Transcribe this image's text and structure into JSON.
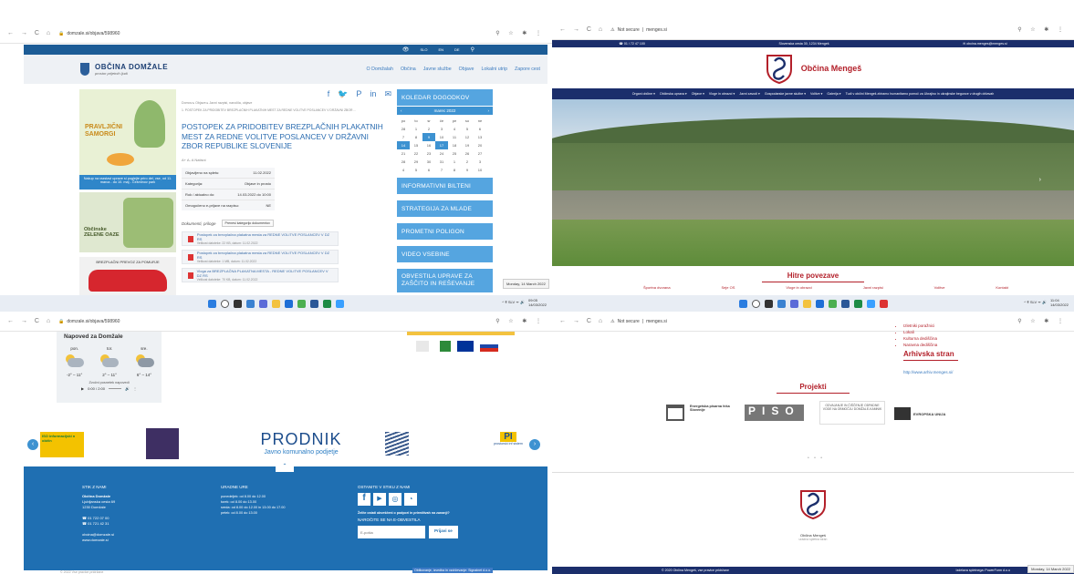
{
  "q1": {
    "url": "domzale.si/objava/598960",
    "logo_title": "OBČINA DOMŽALE",
    "logo_sub": "prostor prijetnih ljudi",
    "topbar_items": [
      "SLO",
      "EN",
      "DE"
    ],
    "nav": [
      "O Domžalah",
      "Občina",
      "Javne službe",
      "Objave",
      "Lokalni utrip",
      "Zapore cest"
    ],
    "breadcrumb": "Domov ▸ Objave ▸ Javni razpisi, naročila, objave",
    "breadcrumb2": "1. POSTOPEK ZA PRIDOBITEV BREZPLAČNIH PLAKATNIH MEST ZA REDNE VOLITVE POSLANCEV V DRŽAVNI ZBOR ...",
    "headline": "POSTOPEK ZA PRIDOBITEV BREZPLAČNIH PLAKATNIH MEST ZA REDNE VOLITVE POSLANCEV V DRŽAVNI ZBOR REPUBLIKE SLOVENIJE",
    "meta_small": "A+ A- A    Natisni",
    "info_rows": [
      {
        "label": "Objavljeno na spletu:",
        "value": "11.02.2022"
      },
      {
        "label": "Kategorija:",
        "value": "Objave in prosto"
      },
      {
        "label": "Rok / aktualno do:",
        "value": "14.03.2022 do 10:00"
      },
      {
        "label": "Omogočeno e-prijave na razpisu:",
        "value": "NE"
      }
    ],
    "docs_label": "Dokumenti, priloge",
    "docs_btn": "Prenesi kategorijo dokumentov",
    "docs": [
      {
        "title": "Postopek za brezplačna plakatna mesta za REDNE VOLITVE POSLANCEV V DZ RS",
        "meta": "Velikost datoteke: 22 KB, datum: 11.02.2022"
      },
      {
        "title": "Postopek za brezplačna plakatna mesta za REDNE VOLITVE POSLANCEV V DZ RS",
        "meta": "Velikost datoteke: 1 MB, datum: 11.02.2022"
      },
      {
        "title": "Vloga za BREZPLAČNA PLAKATNA MESTA - REDNE VOLITVE POSLANCEV V DZ RS",
        "meta": "Velikost datoteke: 70 KB, datum: 11.02.2022"
      }
    ],
    "calendar_title": "KOLEDAR DOGODKOV",
    "calendar_month": "marec 2022",
    "calendar_days": [
      "po",
      "to",
      "sr",
      "če",
      "pe",
      "so",
      "ne"
    ],
    "calendar_rows": [
      [
        "28",
        "1",
        "2",
        "3",
        "4",
        "5",
        "6"
      ],
      [
        "7",
        "8",
        "9",
        "10",
        "11",
        "12",
        "13"
      ],
      [
        "14",
        "15",
        "16",
        "17",
        "18",
        "19",
        "20"
      ],
      [
        "21",
        "22",
        "23",
        "24",
        "25",
        "26",
        "27"
      ],
      [
        "28",
        "29",
        "30",
        "31",
        "1",
        "2",
        "3"
      ],
      [
        "4",
        "5",
        "6",
        "7",
        "8",
        "9",
        "10"
      ]
    ],
    "side_buttons": [
      "INFORMATIVNI BILTENI",
      "STRATEGIJA ZA MLADE",
      "PROMETNI POLIGON",
      "VIDEO VSEBINE",
      "OBVESTILA UPRAVE ZA ZAŠČITO IN REŠEVANJE"
    ],
    "banner1_title": "PRAVLJIČNI SAMORGI",
    "banner1_text": "Nakup na razstavi uprave si poglejte priro del, vse, od 11. marca - do 10. maj - Češminov park",
    "banner2_title": "Občinske ZELENE OAZE",
    "banner3_title": "BREZPLAČNI PREVOZ ZA POMURJE",
    "date_tooltip": "Monday, 14 March 2022",
    "time": "09:05",
    "date": "14/03/2022"
  },
  "q2": {
    "url": "menges.si",
    "not_secure": "Not secure",
    "top_phone": "☎ 01 / 72 47 100",
    "top_address": "Slovenska cesta 30, 1234 Mengeš",
    "top_email": "✉ obcina.menges@menges.si",
    "title": "Občina Mengeš",
    "nav": [
      "Organi občine ▾",
      "Občinska uprava ▾",
      "Objave ▾",
      "Vloge in obrazci ▾",
      "Javni zavodi ▾",
      "Gospodarske javne službe ▾",
      "Volitve ▾",
      "Galerija ▾",
      "Tudi v občini Mengeš zbiramo humanitarno pomoč za Ukrajino in ukrajinske begunce v drugih državah"
    ],
    "quick_title": "Hitre povezave",
    "quick_links": [
      "Športna dvorana",
      "Seje OS",
      "Vloge in obrazci",
      "Javni razpisi",
      "Volitve",
      "Kontakt"
    ],
    "time": "11:04",
    "date": "14/03/2022"
  },
  "q3": {
    "url": "domzale.si/objava/598960",
    "weather_title": "Napoved za Domžale",
    "weather_days": [
      "pon.",
      "tor.",
      "sre."
    ],
    "weather_temps": [
      "-2° – 11°",
      "2° – 11°",
      "6° – 14°"
    ],
    "audio_label": "Zvočni posnetek napovedi",
    "audio_time": "0:00 / 2:00",
    "left_logo": "ISO informacijski n občin",
    "prodnik": "PRODNIK",
    "prodnik_sub": "Javno komunalno podjetje",
    "right_logo": "PI",
    "right_logo_sub": "prostorski inf sistem",
    "footer_c1_title": "STIK Z NAMI",
    "footer_c1_lines": [
      "Občina Domžale",
      "Ljubljanska cesta 69",
      "1230 Domžale",
      "",
      "01 722 07 00",
      "01 721 42 31",
      "",
      "obcina@domzale.si",
      "www.domzale.si"
    ],
    "footer_c2_title": "URADNE URE",
    "footer_c2_lines": [
      "ponedeljek: od 8.00 do 12.00",
      "torek: od 8.00 do 13.00",
      "sreda: od 8.00 do 12.00 in 13.00 do 17.00",
      "petek: od 8.00 do 13.00"
    ],
    "footer_c3_title": "OSTANITE V STIKU Z NAMI",
    "footer_c3_q": "Želite ostati obveščeni o podpori in prireditvah na zunanji?",
    "footer_c3_cta": "NAROČITE SE NA E-OBVESTILA",
    "email_placeholder": "E-pošta",
    "subscribe": "Prijavi se",
    "copyright": "© 2022 Vse pravice pridržane",
    "credit": "Oblikovanje, izvedba in vzdrževanje: Signalnet d.o.o."
  },
  "q4": {
    "url": "menges.si",
    "not_secure": "Not secure",
    "list": [
      "Izletniki poražnici",
      "Lokali",
      "Kulturna dediščina",
      "Naravna dediščina"
    ],
    "archive_title": "Arhivska stran",
    "archive_link": "http://www.arhiv.menges.si/",
    "projects_title": "Projekti",
    "proj1": "Energetska pisarna hiša Slovenije",
    "proj2": "PISO",
    "proj3": "ODVAJANJE IN ČIŠČENJE ODPADNE VODE NA OBMOČJU DOMŽALE-KAMNIK",
    "proj4": "EVROPSKA UNIJA",
    "logo_caption": "Občina Mengeš",
    "logo_caption_sub": "uradna spletna stran",
    "footer_left": "© 2020 Občina Mengeš, vse pravice pridržane",
    "footer_right": "Izdelava spletnega: PowerForm d.o.o",
    "date_tooltip": "Monday, 14 March 2022"
  },
  "colors": {
    "domzale_blue": "#1f6fb2",
    "sidebar_blue": "#55a5e0",
    "menges_navy": "#1b2e6b",
    "menges_red": "#b3202a"
  }
}
